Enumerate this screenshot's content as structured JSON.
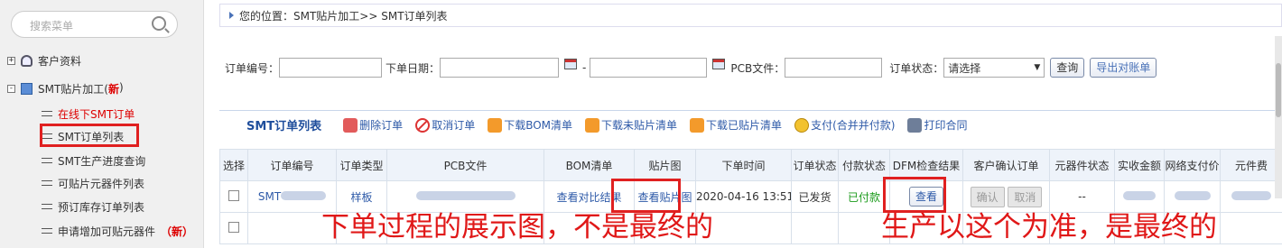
{
  "sidebar": {
    "search_placeholder": "搜索菜单",
    "tree": [
      {
        "label": "客户资料",
        "toggle": "+"
      },
      {
        "label": "SMT贴片加工(",
        "badge": "新",
        "badge_close": ")",
        "toggle": "-"
      }
    ],
    "sub_items": [
      {
        "label": "在线下SMT订单"
      },
      {
        "label": "SMT订单列表"
      },
      {
        "label": "SMT生产进度查询"
      },
      {
        "label": "可贴片元器件列表"
      },
      {
        "label": "预订库存订单列表"
      },
      {
        "label": "申请增加可贴元器件",
        "badge": "（新）"
      }
    ]
  },
  "breadcrumb": {
    "text": "您的位置：SMT贴片加工>> SMT订单列表"
  },
  "filters": {
    "order_no_label": "订单编号：",
    "order_date_label": "下单日期：",
    "date_sep": "-",
    "pcb_label": "PCB文件：",
    "status_label": "订单状态：",
    "status_value": "请选择",
    "query_btn": "查询",
    "export_btn": "导出对账单"
  },
  "toolbar": {
    "title": "SMT订单列表",
    "items": [
      {
        "label": "删除订单",
        "icon": "trash-icon"
      },
      {
        "label": "取消订单",
        "icon": "cancel-icon"
      },
      {
        "label": "下载BOM清单",
        "icon": "download-icon"
      },
      {
        "label": "下载未贴片清单",
        "icon": "download-icon"
      },
      {
        "label": "下载已贴片清单",
        "icon": "download-icon"
      },
      {
        "label": "支付(合并并付款)",
        "icon": "coin-icon"
      },
      {
        "label": "打印合同",
        "icon": "print-icon"
      }
    ]
  },
  "table": {
    "headers": [
      "选择",
      "订单编号",
      "订单类型",
      "PCB文件",
      "BOM清单",
      "贴片图",
      "下单时间",
      "订单状态",
      "付款状态",
      "DFM检查结果",
      "客户确认订单",
      "元器件状态",
      "实收金额",
      "网络支付价",
      "元件费"
    ],
    "row": {
      "order_no": "SMT",
      "order_type": "样板",
      "bom": "查看对比结果",
      "smt_image": "查看贴片图",
      "order_time": "2020-04-16 13:51",
      "status": "已发货",
      "pay_status": "已付款",
      "dfm": "查看",
      "confirm": "确认",
      "cancel": "取消",
      "component_status": "--"
    }
  },
  "annotations": {
    "left_note": "下单过程的展示图，不是最终的",
    "right_note": "生产以这个为准，是最终的"
  },
  "colors": {
    "highlight": "#e02020",
    "link": "#2e5aa8",
    "accent": "#1f4e9c"
  }
}
